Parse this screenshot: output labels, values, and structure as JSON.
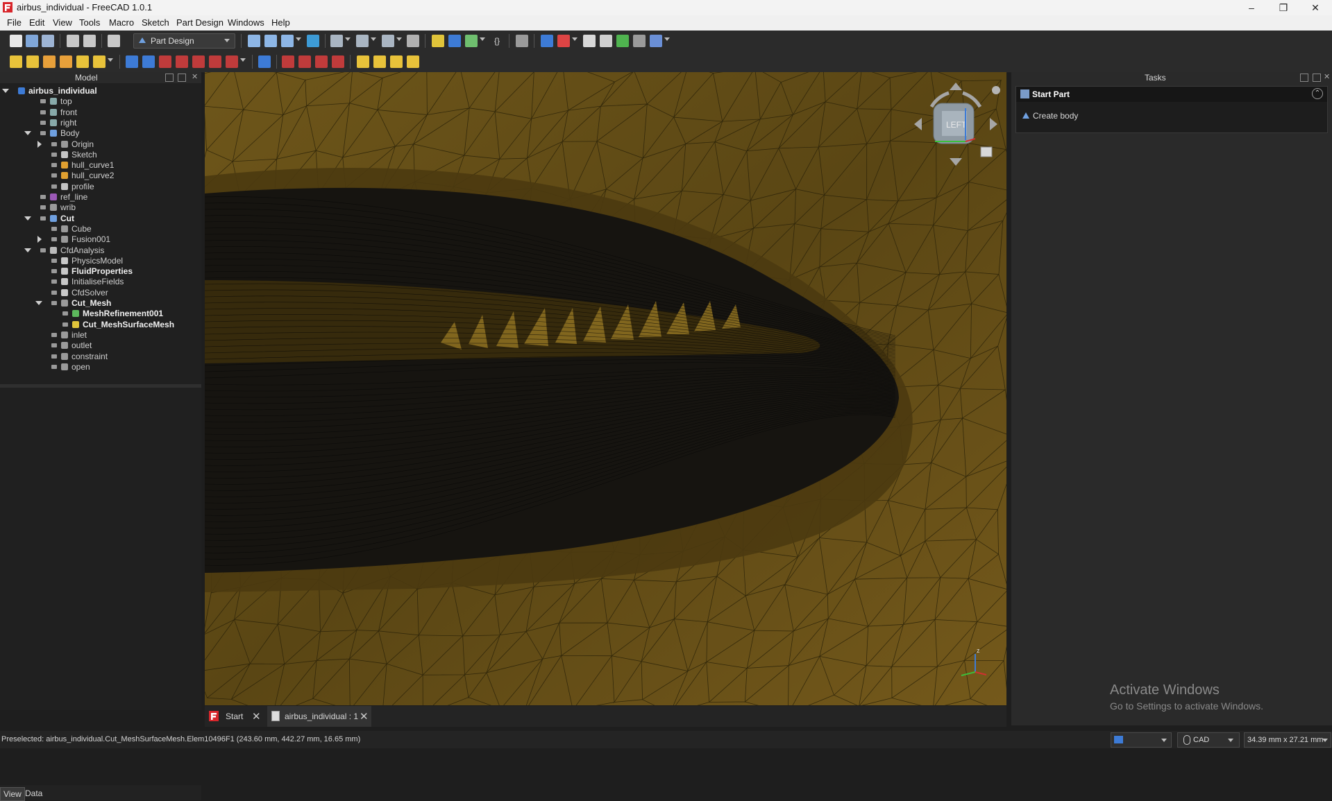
{
  "window": {
    "title": "airbus_individual - FreeCAD 1.0.1",
    "controls": {
      "minimize": "–",
      "restore": "❐",
      "close": "✕"
    }
  },
  "menu": [
    "File",
    "Edit",
    "View",
    "Tools",
    "Macro",
    "Sketch",
    "Part Design",
    "Windows",
    "Help"
  ],
  "toolbar": {
    "workbench": "Part Design"
  },
  "model_panel": {
    "title": "Model",
    "tree": [
      {
        "label": "airbus_individual",
        "bold": true
      },
      {
        "label": "top"
      },
      {
        "label": "front"
      },
      {
        "label": "right"
      },
      {
        "label": "Body"
      },
      {
        "label": "Origin"
      },
      {
        "label": "Sketch"
      },
      {
        "label": "hull_curve1"
      },
      {
        "label": "hull_curve2"
      },
      {
        "label": "profile"
      },
      {
        "label": "ref_line"
      },
      {
        "label": "wrib"
      },
      {
        "label": "Cut",
        "bold": true
      },
      {
        "label": "Cube"
      },
      {
        "label": "Fusion001"
      },
      {
        "label": "CfdAnalysis"
      },
      {
        "label": "PhysicsModel"
      },
      {
        "label": "FluidProperties",
        "bold": true
      },
      {
        "label": "InitialiseFields"
      },
      {
        "label": "CfdSolver"
      },
      {
        "label": "Cut_Mesh",
        "bold": true
      },
      {
        "label": "MeshRefinement001",
        "bold": true
      },
      {
        "label": "Cut_MeshSurfaceMesh",
        "bold": true
      },
      {
        "label": "inlet"
      },
      {
        "label": "outlet"
      },
      {
        "label": "constraint"
      },
      {
        "label": "open"
      }
    ],
    "tabs": [
      "View",
      "Data"
    ]
  },
  "navcube": {
    "face": "LEFT"
  },
  "doc_tabs": [
    "Start",
    "airbus_individual : 1"
  ],
  "tasks_panel": {
    "title": "Tasks",
    "section_title": "Start Part",
    "action": "Create body"
  },
  "watermark": {
    "line1": "Activate Windows",
    "line2": "Go to Settings to activate Windows."
  },
  "statusbar": {
    "message": "Preselected: airbus_individual.Cut_MeshSurfaceMesh.Elem10496F1 (243.60 mm, 442.27 mm, 16.65 mm)",
    "nav_style": "CAD",
    "dimensions": "34.39 mm x 27.21 mm"
  },
  "colors": {
    "viewport_fill": "#6b5418",
    "mesh_line": "#2a2208",
    "accent_blue": "#3d7bd6"
  }
}
